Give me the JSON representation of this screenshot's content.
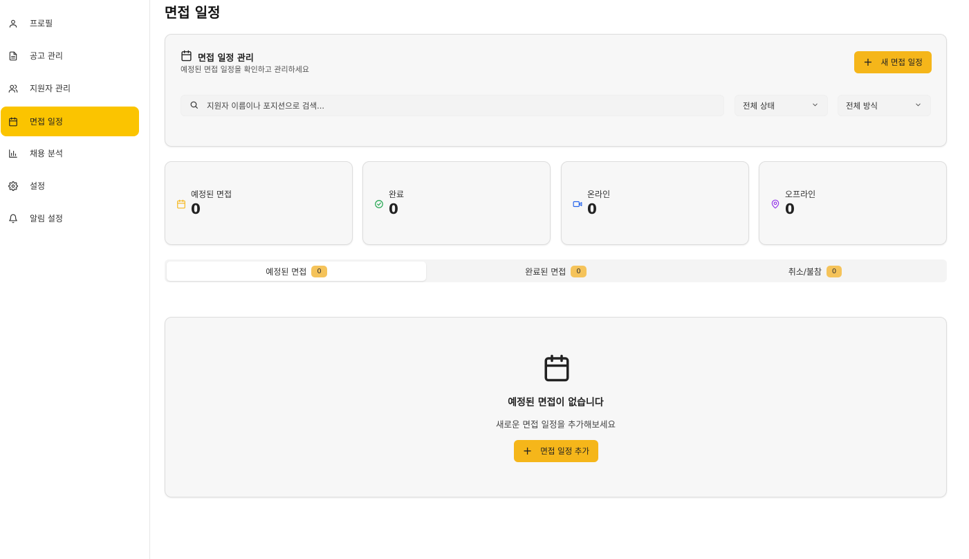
{
  "sidebar": {
    "items": [
      {
        "label": "프로필",
        "icon": "user-icon",
        "active": false
      },
      {
        "label": "공고 관리",
        "icon": "document-icon",
        "active": false
      },
      {
        "label": "지원자 관리",
        "icon": "users-icon",
        "active": false
      },
      {
        "label": "면접 일정",
        "icon": "calendar-icon",
        "active": true
      },
      {
        "label": "채용 분석",
        "icon": "bar-chart-icon",
        "active": false
      },
      {
        "label": "설정",
        "icon": "gear-icon",
        "active": false
      },
      {
        "label": "알림 설정",
        "icon": "bell-icon",
        "active": false
      }
    ]
  },
  "page": {
    "title": "면접 일정"
  },
  "management": {
    "title": "면접 일정 관리",
    "subtitle": "예정된 면접 일정을 확인하고 관리하세요",
    "new_button": "새 면접 일정",
    "search_placeholder": "지원자 이름이나 포지션으로 검색...",
    "status_filter": "전체 상태",
    "method_filter": "전체 방식"
  },
  "stats": [
    {
      "label": "예정된 면접",
      "value": "0",
      "icon": "calendar-icon",
      "color": "#f5b61a"
    },
    {
      "label": "완료",
      "value": "0",
      "icon": "check-circle-icon",
      "color": "#1aa34a"
    },
    {
      "label": "온라인",
      "value": "0",
      "icon": "video-icon",
      "color": "#2563eb"
    },
    {
      "label": "오프라인",
      "value": "0",
      "icon": "map-pin-icon",
      "color": "#9333ea"
    }
  ],
  "tabs": [
    {
      "label": "예정된 면접",
      "count": "0",
      "active": true
    },
    {
      "label": "완료된 면접",
      "count": "0",
      "active": false
    },
    {
      "label": "취소/불참",
      "count": "0",
      "active": false
    }
  ],
  "empty_state": {
    "title": "예정된 면접이 없습니다",
    "subtitle": "새로운 면접 일정을 추가해보세요",
    "button": "면접 일정 추가"
  },
  "colors": {
    "accent": "#fbc400",
    "button": "#f5b61a",
    "badge": "#f5c35a"
  }
}
